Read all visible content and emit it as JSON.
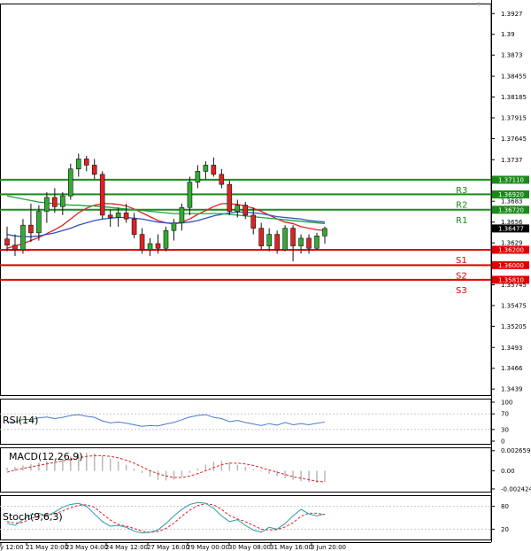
{
  "chart_data": [
    {
      "type": "candlestick",
      "title": "",
      "ylim": [
        1.343,
        1.394
      ],
      "yticks": [
        1.3927,
        1.39,
        1.3873,
        1.38455,
        1.38185,
        1.37915,
        1.37645,
        1.3737,
        1.3711,
        1.3683,
        1.3656,
        1.3629,
        1.3602,
        1.35745,
        1.35475,
        1.35205,
        1.3493,
        1.3466,
        1.3439
      ],
      "current_price": "1.36477",
      "candles": [
        {
          "o": 1.3634,
          "h": 1.365,
          "l": 1.3618,
          "c": 1.3626
        },
        {
          "o": 1.3626,
          "h": 1.364,
          "l": 1.3612,
          "c": 1.362
        },
        {
          "o": 1.362,
          "h": 1.366,
          "l": 1.3615,
          "c": 1.3652
        },
        {
          "o": 1.3652,
          "h": 1.368,
          "l": 1.363,
          "c": 1.3642
        },
        {
          "o": 1.3642,
          "h": 1.3678,
          "l": 1.3632,
          "c": 1.367
        },
        {
          "o": 1.367,
          "h": 1.3695,
          "l": 1.3655,
          "c": 1.3688
        },
        {
          "o": 1.3688,
          "h": 1.37,
          "l": 1.3668,
          "c": 1.3676
        },
        {
          "o": 1.3676,
          "h": 1.3695,
          "l": 1.3665,
          "c": 1.369
        },
        {
          "o": 1.369,
          "h": 1.3732,
          "l": 1.3685,
          "c": 1.3725
        },
        {
          "o": 1.3725,
          "h": 1.3745,
          "l": 1.3715,
          "c": 1.3738
        },
        {
          "o": 1.3738,
          "h": 1.3742,
          "l": 1.3722,
          "c": 1.373
        },
        {
          "o": 1.373,
          "h": 1.3738,
          "l": 1.3712,
          "c": 1.3718
        },
        {
          "o": 1.3718,
          "h": 1.3722,
          "l": 1.366,
          "c": 1.3665
        },
        {
          "o": 1.3665,
          "h": 1.3672,
          "l": 1.365,
          "c": 1.3662
        },
        {
          "o": 1.3662,
          "h": 1.3675,
          "l": 1.365,
          "c": 1.3668
        },
        {
          "o": 1.3668,
          "h": 1.368,
          "l": 1.3655,
          "c": 1.366
        },
        {
          "o": 1.366,
          "h": 1.3668,
          "l": 1.3635,
          "c": 1.364
        },
        {
          "o": 1.364,
          "h": 1.3648,
          "l": 1.3615,
          "c": 1.362
        },
        {
          "o": 1.362,
          "h": 1.3635,
          "l": 1.3612,
          "c": 1.3628
        },
        {
          "o": 1.3628,
          "h": 1.364,
          "l": 1.3615,
          "c": 1.3622
        },
        {
          "o": 1.3622,
          "h": 1.365,
          "l": 1.3618,
          "c": 1.3645
        },
        {
          "o": 1.3645,
          "h": 1.366,
          "l": 1.3632,
          "c": 1.3655
        },
        {
          "o": 1.3655,
          "h": 1.368,
          "l": 1.3645,
          "c": 1.3675
        },
        {
          "o": 1.3675,
          "h": 1.3715,
          "l": 1.3665,
          "c": 1.3708
        },
        {
          "o": 1.3708,
          "h": 1.373,
          "l": 1.37,
          "c": 1.3722
        },
        {
          "o": 1.3722,
          "h": 1.3735,
          "l": 1.3712,
          "c": 1.373
        },
        {
          "o": 1.373,
          "h": 1.374,
          "l": 1.3715,
          "c": 1.3718
        },
        {
          "o": 1.3718,
          "h": 1.3725,
          "l": 1.37,
          "c": 1.3705
        },
        {
          "o": 1.3705,
          "h": 1.371,
          "l": 1.3665,
          "c": 1.367
        },
        {
          "o": 1.367,
          "h": 1.3685,
          "l": 1.3662,
          "c": 1.3678
        },
        {
          "o": 1.3678,
          "h": 1.3682,
          "l": 1.366,
          "c": 1.3665
        },
        {
          "o": 1.3665,
          "h": 1.3675,
          "l": 1.364,
          "c": 1.3648
        },
        {
          "o": 1.3648,
          "h": 1.3655,
          "l": 1.362,
          "c": 1.3625
        },
        {
          "o": 1.3625,
          "h": 1.3648,
          "l": 1.3618,
          "c": 1.364
        },
        {
          "o": 1.364,
          "h": 1.3645,
          "l": 1.3615,
          "c": 1.362
        },
        {
          "o": 1.362,
          "h": 1.3652,
          "l": 1.3618,
          "c": 1.3648
        },
        {
          "o": 1.3648,
          "h": 1.3652,
          "l": 1.3605,
          "c": 1.3625
        },
        {
          "o": 1.3625,
          "h": 1.364,
          "l": 1.3615,
          "c": 1.3635
        },
        {
          "o": 1.3635,
          "h": 1.364,
          "l": 1.3615,
          "c": 1.3622
        },
        {
          "o": 1.3622,
          "h": 1.3642,
          "l": 1.362,
          "c": 1.3638
        },
        {
          "o": 1.3638,
          "h": 1.365,
          "l": 1.3628,
          "c": 1.36477
        }
      ],
      "overlays": [
        {
          "color": "#e02020",
          "values": [
            1.3622,
            1.3625,
            1.3628,
            1.3632,
            1.3636,
            1.3641,
            1.3646,
            1.3652,
            1.366,
            1.3668,
            1.3674,
            1.3678,
            1.368,
            1.368,
            1.3679,
            1.3677,
            1.3673,
            1.3668,
            1.3663,
            1.3658,
            1.3655,
            1.3654,
            1.3656,
            1.366,
            1.3666,
            1.3671,
            1.3676,
            1.368,
            1.368,
            1.3679,
            1.3677,
            1.3674,
            1.367,
            1.3665,
            1.366,
            1.3656,
            1.3654,
            1.365,
            1.3648,
            1.3646,
            1.3645
          ]
        },
        {
          "color": "#3050c0",
          "values": [
            1.364,
            1.3638,
            1.3637,
            1.3637,
            1.3638,
            1.364,
            1.3642,
            1.3645,
            1.3648,
            1.3652,
            1.3655,
            1.3658,
            1.366,
            1.3661,
            1.3662,
            1.3662,
            1.3661,
            1.366,
            1.3658,
            1.3656,
            1.3655,
            1.3654,
            1.3655,
            1.3656,
            1.3658,
            1.3661,
            1.3664,
            1.3666,
            1.3668,
            1.3669,
            1.3669,
            1.3668,
            1.3667,
            1.3665,
            1.3663,
            1.3662,
            1.3661,
            1.366,
            1.3658,
            1.3657,
            1.3656
          ]
        },
        {
          "color": "#20a040",
          "values": [
            1.369,
            1.3688,
            1.3686,
            1.3684,
            1.3682,
            1.3681,
            1.368,
            1.3679,
            1.3678,
            1.3678,
            1.3677,
            1.3677,
            1.3676,
            1.3675,
            1.3674,
            1.3673,
            1.3672,
            1.3671,
            1.367,
            1.3669,
            1.3668,
            1.3667,
            1.3667,
            1.3667,
            1.3667,
            1.3667,
            1.3667,
            1.3667,
            1.3666,
            1.3665,
            1.3664,
            1.3663,
            1.3662,
            1.3661,
            1.366,
            1.3659,
            1.3658,
            1.3657,
            1.3656,
            1.3655,
            1.3654
          ]
        }
      ],
      "levels": [
        {
          "name": "R3",
          "value": "1.37110",
          "color": "#1a8a1a"
        },
        {
          "name": "R2",
          "value": "1.36920",
          "color": "#1a8a1a"
        },
        {
          "name": "R1",
          "value": "1.36720",
          "color": "#1a8a1a"
        },
        {
          "name": "S1",
          "value": "1.36200",
          "color": "#e00000"
        },
        {
          "name": "S2",
          "value": "1.36000",
          "color": "#e00000"
        },
        {
          "name": "S3",
          "value": "1.35810",
          "color": "#e00000"
        }
      ],
      "colors": {
        "up": "#33aa33",
        "down": "#dd2222"
      }
    },
    {
      "type": "line",
      "title": "RSI(14)",
      "ylim": [
        0,
        100
      ],
      "yticks": [
        "100",
        "70",
        "30",
        "0"
      ],
      "series": [
        {
          "color": "#4a7ad0",
          "values": [
            50,
            49,
            56,
            55,
            60,
            62,
            58,
            61,
            66,
            68,
            64,
            61,
            52,
            47,
            49,
            46,
            42,
            38,
            40,
            39,
            44,
            48,
            55,
            62,
            66,
            68,
            61,
            58,
            50,
            53,
            48,
            44,
            40,
            45,
            41,
            48,
            42,
            45,
            42,
            46,
            49
          ]
        }
      ]
    },
    {
      "type": "bar",
      "title": "MACD(12,26,9)",
      "ylim": [
        -0.0029,
        0.0031
      ],
      "yticks": [
        "0.002659",
        "0.00",
        "-0.002424"
      ],
      "values": [
        0.0004,
        0.0005,
        0.0007,
        0.0009,
        0.0011,
        0.0013,
        0.0014,
        0.0016,
        0.0019,
        0.0022,
        0.0024,
        0.0023,
        0.002,
        0.0016,
        0.0012,
        0.0008,
        0.0003,
        -0.0003,
        -0.0008,
        -0.0012,
        -0.0013,
        -0.0012,
        -0.0008,
        -0.0003,
        0.0003,
        0.0008,
        0.0012,
        0.0013,
        0.0011,
        0.0008,
        0.0005,
        0.0002,
        -0.0001,
        -0.0004,
        -0.0007,
        -0.001,
        -0.0012,
        -0.0014,
        -0.0015,
        -0.0016,
        -0.0015
      ],
      "signal": [
        -0.0002,
        0.0001,
        0.0003,
        0.0005,
        0.0007,
        0.0009,
        0.0011,
        0.0013,
        0.0015,
        0.0017,
        0.0019,
        0.002,
        0.002,
        0.0019,
        0.0017,
        0.0014,
        0.001,
        0.0005,
        0.0,
        -0.0004,
        -0.0007,
        -0.0009,
        -0.0009,
        -0.0007,
        -0.0004,
        0.0,
        0.0004,
        0.0008,
        0.001,
        0.001,
        0.0009,
        0.0007,
        0.0004,
        0.0001,
        -0.0002,
        -0.0005,
        -0.0008,
        -0.001,
        -0.0012,
        -0.0014,
        -0.0015
      ],
      "colors": {
        "histogram": "#b8b8b8",
        "signal": "#e02020"
      }
    },
    {
      "type": "line",
      "title": "Stoch(9,6,3)",
      "ylim": [
        0,
        100
      ],
      "yticks": [
        "80",
        "20"
      ],
      "series": [
        {
          "color": "#2a9aa8",
          "values": [
            35,
            30,
            45,
            58,
            62,
            55,
            65,
            78,
            85,
            88,
            80,
            60,
            40,
            28,
            30,
            25,
            15,
            10,
            12,
            18,
            35,
            55,
            72,
            85,
            90,
            88,
            75,
            55,
            40,
            45,
            30,
            18,
            12,
            25,
            20,
            35,
            55,
            72,
            60,
            55,
            60
          ]
        },
        {
          "color": "#e02020",
          "values": [
            40,
            36,
            38,
            48,
            55,
            58,
            60,
            68,
            76,
            83,
            84,
            78,
            60,
            44,
            33,
            28,
            22,
            15,
            12,
            14,
            22,
            36,
            54,
            70,
            82,
            87,
            84,
            72,
            56,
            47,
            40,
            30,
            20,
            18,
            19,
            26,
            37,
            54,
            62,
            62,
            58
          ]
        }
      ]
    }
  ],
  "x_axis": {
    "labels": [
      "y 12:00",
      "21 May 20:00",
      "23 May 04:00",
      "24 May 12:00",
      "27 May 16:00",
      "29 May 00:00",
      "30 May 08:00",
      "31 May 16:00",
      "3 Jun 20:00"
    ]
  }
}
